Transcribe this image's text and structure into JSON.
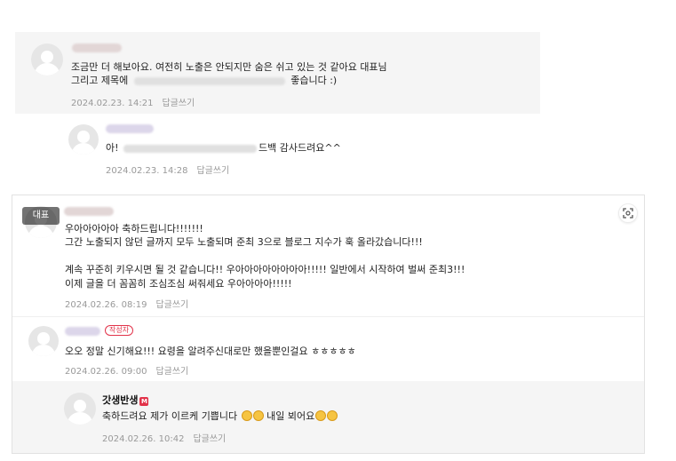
{
  "comment1": {
    "line1": "조금만 더 해보아요. 여전히 노출은 안되지만 숨은 쉬고 있는 것 같아요 대표님",
    "line2_start": "그리고 제목에",
    "line2_end": "좋습니다 :)",
    "date": "2024.02.23. 14:21",
    "reply": "답글쓰기"
  },
  "reply1": {
    "text_start": "아!",
    "text_end": "드백 감사드려요^^",
    "date": "2024.02.23. 14:28",
    "reply": "답글쓰기"
  },
  "comment2": {
    "rep_badge": "대표",
    "line1": "우아아아아아 축하드립니다!!!!!!!",
    "line2": "그간 노출되지 않던 글까지 모두 노출되며 준최 3으로 블로그 지수가 훅 올라갔습니다!!!",
    "line3": "계속 꾸준히 키우시면 될 것 같습니다!! 우아아아아아아아아!!!!! 일반에서 시작하여 벌써 준최3!!!",
    "line4": "이제 글을 더 꼼꼼히 조심조심 써줘세요 우아아아아!!!!!",
    "date": "2024.02.26. 08:19",
    "reply": "답글쓰기"
  },
  "comment3": {
    "author_badge": "작성자",
    "text": "오오 정말 신기해요!!! 요령을 알려주신대로만 했을뿐인걸요 ㅎㅎㅎㅎㅎ",
    "date": "2024.02.26. 09:00",
    "reply": "답글쓰기"
  },
  "reply2": {
    "name": "갓생반생",
    "name_badge": "M",
    "text_start": "축하드려요 제가 이르케 기쁩니다",
    "text_mid": "내일 뵈어요",
    "date": "2024.02.26. 10:42",
    "reply": "답글쓰기"
  },
  "colors": {
    "comment_bg": "#f5f5f5",
    "meta_text": "#999999",
    "accent_red": "#e2334a"
  }
}
